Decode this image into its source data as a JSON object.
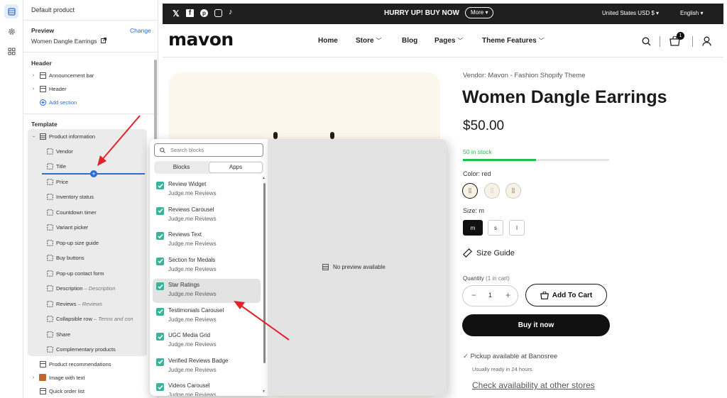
{
  "sidebar": {
    "title": "Default product",
    "preview_heading": "Preview",
    "change_link": "Change",
    "preview_product": "Women Dangle Earrings",
    "header_heading": "Header",
    "header_items": [
      {
        "label": "Announcement bar"
      },
      {
        "label": "Header"
      }
    ],
    "add_section": "Add section",
    "template_heading": "Template",
    "product_information": "Product information",
    "blocks": [
      {
        "label": "Vendor",
        "sub": ""
      },
      {
        "label": "Title",
        "sub": ""
      },
      {
        "label": "Price",
        "sub": ""
      },
      {
        "label": "Inventory status",
        "sub": ""
      },
      {
        "label": "Countdown timer",
        "sub": ""
      },
      {
        "label": "Variant picker",
        "sub": ""
      },
      {
        "label": "Pop-up size guide",
        "sub": ""
      },
      {
        "label": "Buy buttons",
        "sub": ""
      },
      {
        "label": "Pop-up contact form",
        "sub": ""
      },
      {
        "label": "Description",
        "sub": "Description"
      },
      {
        "label": "Reviews",
        "sub": "Reviews"
      },
      {
        "label": "Collapsible row",
        "sub": "Terms and con"
      },
      {
        "label": "Share",
        "sub": ""
      },
      {
        "label": "Complementary products",
        "sub": ""
      }
    ],
    "sections_after": [
      {
        "label": "Product recommendations"
      },
      {
        "label": "Image with text"
      },
      {
        "label": "Quick order list"
      }
    ]
  },
  "popup": {
    "search_placeholder": "Search blocks",
    "tabs": [
      "Blocks",
      "Apps"
    ],
    "active_tab": "Apps",
    "items": [
      {
        "name": "Review Widget",
        "app": "Judge.me Reviews"
      },
      {
        "name": "Reviews Carousel",
        "app": "Judge.me Reviews"
      },
      {
        "name": "Reviews Text",
        "app": "Judge.me Reviews"
      },
      {
        "name": "Section for Medals",
        "app": "Judge.me Reviews"
      },
      {
        "name": "Star Ratings",
        "app": "Judge.me Reviews"
      },
      {
        "name": "Testimonials Carousel",
        "app": "Judge.me Reviews"
      },
      {
        "name": "UGC Media Grid",
        "app": "Judge.me Reviews"
      },
      {
        "name": "Verified Reviews Badge",
        "app": "Judge.me Reviews"
      },
      {
        "name": "Videos Carousel",
        "app": "Judge.me Reviews"
      }
    ],
    "highlighted_item": "Star Ratings",
    "no_preview": "No preview available"
  },
  "store": {
    "announcement": "HURRY UP! BUY NOW",
    "more_button": "More",
    "currency": "United States USD $",
    "language": "English",
    "logo": "mavon",
    "nav": [
      "Home",
      "Store",
      "Blog",
      "Pages",
      "Theme Features"
    ],
    "cart_count": "1"
  },
  "product": {
    "vendor_label": "Vendor:",
    "vendor": "Mavon - Fashion Shopify Theme",
    "title": "Women Dangle Earrings",
    "price": "$50.00",
    "stock": "50 in stock",
    "stock_fraction": 0.5,
    "color_label": "Color:",
    "color_value": "red",
    "size_label": "Size:",
    "size_value": "m",
    "sizes": [
      "m",
      "s",
      "l"
    ],
    "size_guide": "Size Guide",
    "quantity_label": "Quantity",
    "quantity_note": "(1 in cart)",
    "quantity": "1",
    "add_to_cart": "Add To Cart",
    "buy_now": "Buy it now",
    "pickup_prefix": "Pickup available at",
    "pickup_store": "Banosree",
    "pickup_time": "Usually ready in 24 hours",
    "check_availability": "Check availability at other stores"
  },
  "colors": {
    "accent_blue": "#2c6ecb",
    "stock_green": "#1fbf4d",
    "annotation_red": "#e3222b",
    "app_check": "#3bb39a"
  }
}
